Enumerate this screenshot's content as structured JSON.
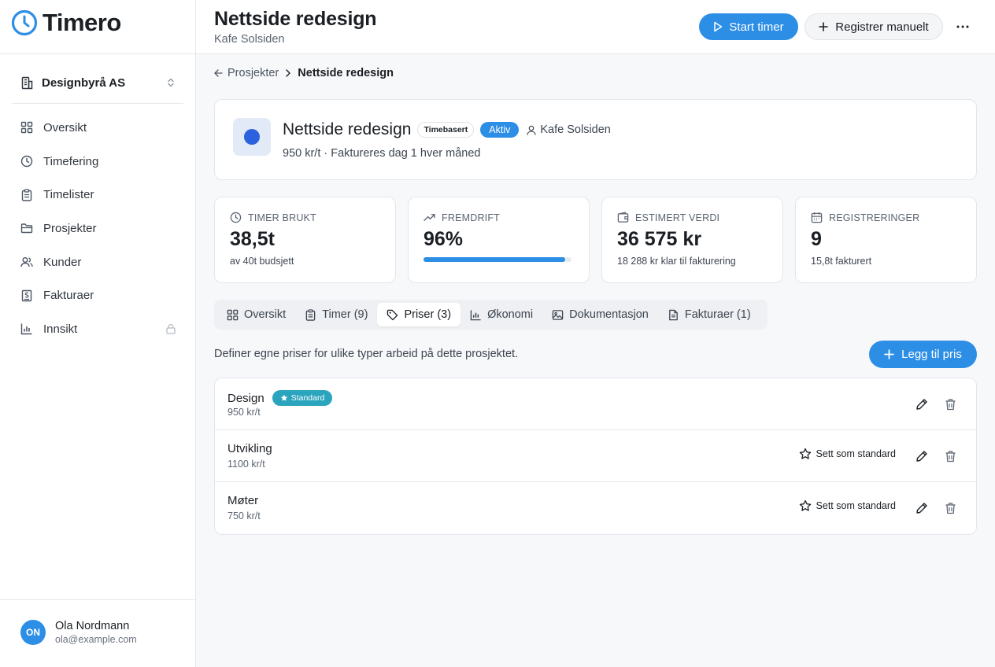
{
  "app": {
    "name": "Timero",
    "accent": "#2d8ee6"
  },
  "sidebar": {
    "org": "Designbyrå AS",
    "items": [
      {
        "label": "Oversikt",
        "icon": "grid-icon"
      },
      {
        "label": "Timefering",
        "icon": "clock-icon"
      },
      {
        "label": "Timelister",
        "icon": "clipboard-icon"
      },
      {
        "label": "Prosjekter",
        "icon": "folder-icon"
      },
      {
        "label": "Kunder",
        "icon": "users-icon"
      },
      {
        "label": "Fakturaer",
        "icon": "invoice-icon"
      },
      {
        "label": "Innsikt",
        "icon": "bar-chart-icon",
        "locked": true
      }
    ],
    "user": {
      "initials": "ON",
      "name": "Ola Nordmann",
      "email": "ola@example.com"
    }
  },
  "header": {
    "title": "Nettside redesign",
    "subtitle": "Kafe Solsiden",
    "start_timer": "Start timer",
    "register_manual": "Registrer manuelt"
  },
  "breadcrumb": {
    "parent": "Prosjekter",
    "current": "Nettside redesign"
  },
  "project": {
    "name": "Nettside redesign",
    "type_tag": "Timebasert",
    "status": "Aktiv",
    "client": "Kafe Solsiden",
    "meta": "950 kr/t · Faktureres dag 1 hver måned",
    "color": "#2c62de"
  },
  "stats": [
    {
      "label": "TIMER BRUKT",
      "value": "38,5t",
      "sub": "av 40t budsjett",
      "icon": "clock-icon"
    },
    {
      "label": "FREMDRIFT",
      "value": "96%",
      "progress": 0.96,
      "icon": "trending-up-icon"
    },
    {
      "label": "ESTIMERT VERDI",
      "value": "36 575 kr",
      "sub": "18 288 kr klar til fakturering",
      "icon": "wallet-icon"
    },
    {
      "label": "REGISTRERINGER",
      "value": "9",
      "sub": "15,8t fakturert",
      "icon": "calendar-icon"
    }
  ],
  "tabs": [
    {
      "label": "Oversikt",
      "icon": "grid-icon"
    },
    {
      "label": "Timer (9)",
      "icon": "clipboard-icon"
    },
    {
      "label": "Priser (3)",
      "icon": "tag-icon",
      "active": true
    },
    {
      "label": "Økonomi",
      "icon": "bar-chart-icon"
    },
    {
      "label": "Dokumentasjon",
      "icon": "image-icon"
    },
    {
      "label": "Fakturaer (1)",
      "icon": "document-icon"
    }
  ],
  "prices": {
    "description": "Definer egne priser for ulike typer arbeid på dette prosjektet.",
    "add_label": "Legg til pris",
    "standard_badge": "Standard",
    "set_standard_label": "Sett som standard",
    "items": [
      {
        "name": "Design",
        "rate": "950 kr/t",
        "is_standard": true
      },
      {
        "name": "Utvikling",
        "rate": "1100 kr/t",
        "is_standard": false
      },
      {
        "name": "Møter",
        "rate": "750 kr/t",
        "is_standard": false
      }
    ]
  }
}
